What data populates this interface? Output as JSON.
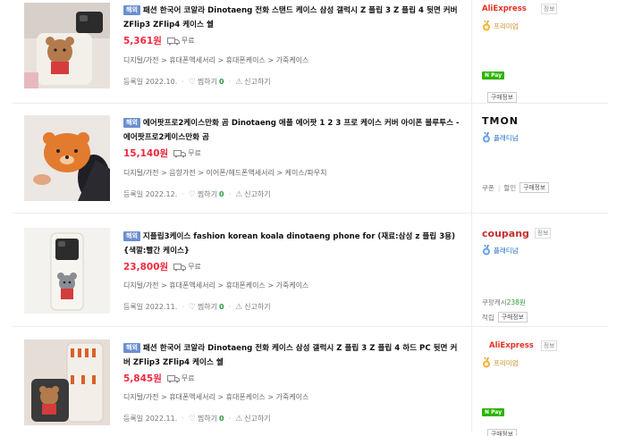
{
  "colors": {
    "price": "#f02a3e",
    "badge": "#6a8fd1",
    "count": "#2e9a3e",
    "aliexpress": "#e43225",
    "coupang_grade_text": "#2a6fc9",
    "npay": "#2db400"
  },
  "items": [
    {
      "badge": "해외",
      "title": "패션 한국어 코알라 Dinotaeng 전화 스탠드 케이스 삼성 갤럭시 Z 플립 3 Z 플립 4 뒷면 커버 ZFlip3 ZFlip4 케이스 쉘",
      "price": "5,361원",
      "shipping": "무료",
      "category": [
        "디지털/가전",
        "휴대폰액세서리",
        "휴대폰케이스",
        "가죽케이스"
      ],
      "reg_date": "등록일 2022.10.",
      "wish_label": "찜하기",
      "wish_count": "0",
      "report_label": "신고하기",
      "mall": {
        "name": "AliExpress",
        "logo_icon": "aliexpress-logo",
        "info_tag": "정보",
        "grade": "프리미엄",
        "grade_icon": "gold-medal-icon",
        "npay": "N Pay",
        "buy_info": "구매정보"
      },
      "thumb_icon": "phone-flip-case-bear-photo"
    },
    {
      "badge": "해외",
      "title": "에어팟프로2케이스만화 곰 Dinotaeng 애플 에어팟 1 2 3 프로 케이스 커버 아이폰 블루투스 - 에어팟프로2케이스만화 곰",
      "price": "15,140원",
      "shipping": "무료",
      "category": [
        "디지털/가전",
        "음향가전",
        "이어폰/헤드폰액세서리",
        "케이스/파우치"
      ],
      "reg_date": "등록일 2022.12.",
      "wish_label": "찜하기",
      "wish_count": "0",
      "report_label": "신고하기",
      "mall": {
        "name": "TMON",
        "logo_icon": "tmon-logo",
        "grade": "플래티넘",
        "grade_icon": "platinum-medal-icon",
        "coupon": "쿠폰",
        "discount": "할인",
        "buy_info": "구매정보"
      },
      "thumb_icon": "airpods-bear-case-photo"
    },
    {
      "badge": "해외",
      "title": "지플립3케이스 fashion korean koala dinotaeng phone for (재료:삼성 z 플립 3용) {색깔:빨간 케이스}",
      "price": "23,800원",
      "shipping": "무료",
      "category": [
        "디지털/가전",
        "휴대폰액세서리",
        "휴대폰케이스",
        "가죽케이스"
      ],
      "reg_date": "등록일 2022.11.",
      "wish_label": "찜하기",
      "wish_count": "0",
      "report_label": "신고하기",
      "mall": {
        "name": "coupang",
        "logo_icon": "coupang-logo",
        "info_tag": "정보",
        "grade": "플래티넘",
        "grade_icon": "platinum-medal-icon",
        "cash_label": "쿠팡캐시",
        "cash_value": "238원",
        "accumulate": "적립",
        "buy_info": "구매정보"
      },
      "thumb_icon": "flip-phone-koala-case-photo"
    },
    {
      "badge": "해외",
      "title": "패션 한국어 코알라 Dinotaeng 전화 케이스 삼성 갤럭시 Z 플립 3 Z 플립 4 하드 PC 뒷면 커버 ZFlip3 ZFlip4 케이스 쉘",
      "price": "5,845원",
      "shipping": "무료",
      "category": [
        "디지털/가전",
        "휴대폰액세서리",
        "휴대폰케이스",
        "가죽케이스"
      ],
      "reg_date": "등록일 2022.11.",
      "wish_label": "찜하기",
      "wish_count": "0",
      "report_label": "신고하기",
      "mall": {
        "name": "AliExpress",
        "logo_icon": "aliexpress-logo",
        "info_tag": "정보",
        "grade": "프리미엄",
        "grade_icon": "gold-medal-icon",
        "npay": "N Pay",
        "buy_info": "구매정보"
      },
      "thumb_icon": "flip-phone-bear-pattern-photo"
    }
  ]
}
